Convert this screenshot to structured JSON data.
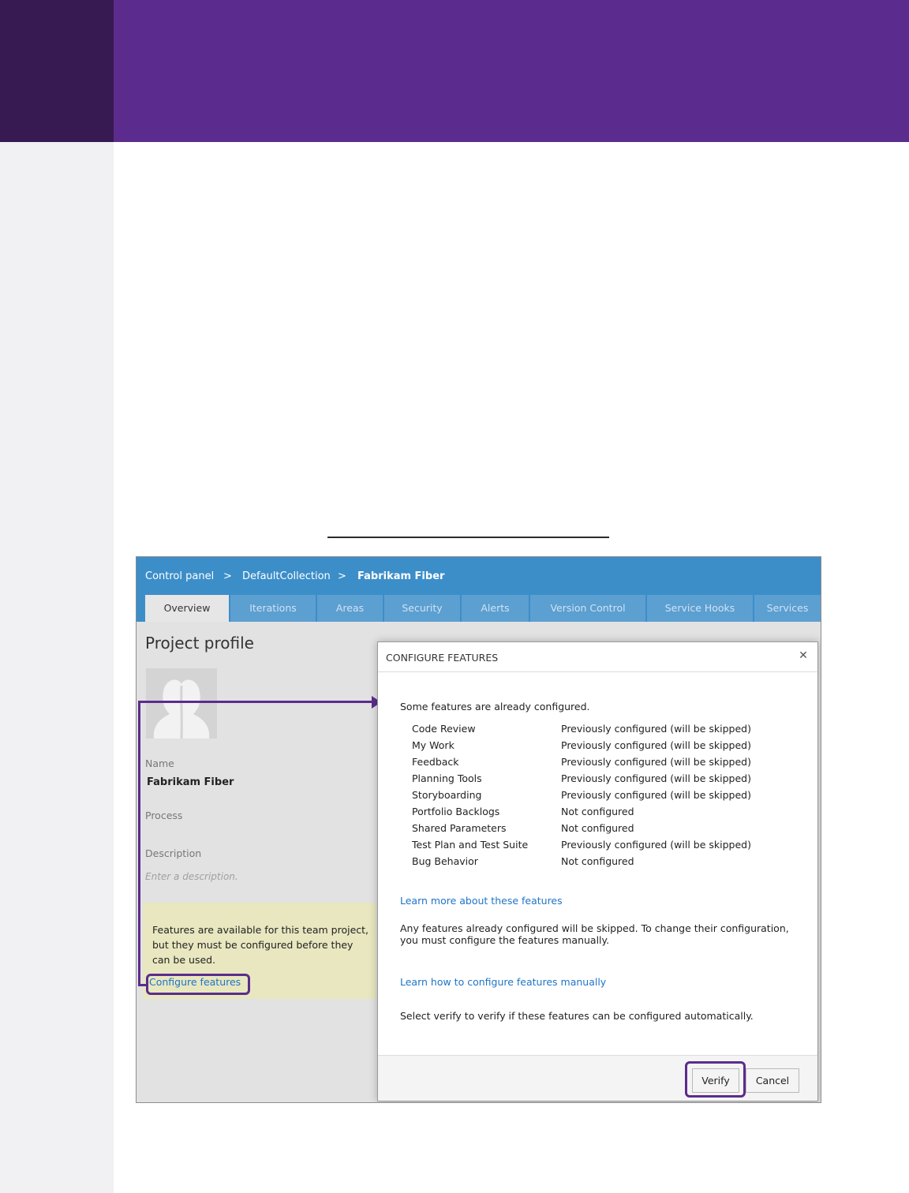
{
  "colors": {
    "brand_purple": "#5b2c8d",
    "rail_dark": "#371a52",
    "nav_blue": "#3c8ec9",
    "link_blue": "#1f74c7",
    "notice_yellow": "#e8e7c0"
  },
  "breadcrumb": {
    "item1": "Control panel",
    "sep1": ">",
    "item2": "DefaultCollection",
    "sep2": ">",
    "item3": "Fabrikam Fiber"
  },
  "tabs": [
    "Overview",
    "Iterations",
    "Areas",
    "Security",
    "Alerts",
    "Version Control",
    "Service Hooks",
    "Services"
  ],
  "profile": {
    "title": "Project profile",
    "avatar_icon": "user-silhouette-icon",
    "name_label": "Name",
    "name_value": "Fabrikam Fiber",
    "process_label": "Process",
    "description_label": "Description",
    "description_placeholder": "Enter a description."
  },
  "notice": {
    "text": "Features are available for this team project, but they must be configured before they can be used.",
    "link": "Configure features"
  },
  "dialog": {
    "title": "CONFIGURE FEATURES",
    "close_icon": "close-icon",
    "intro": "Some features are already configured.",
    "features": [
      {
        "name": "Code Review",
        "status": "Previously configured (will be skipped)"
      },
      {
        "name": "My Work",
        "status": "Previously configured (will be skipped)"
      },
      {
        "name": "Feedback",
        "status": "Previously configured (will be skipped)"
      },
      {
        "name": "Planning Tools",
        "status": "Previously configured (will be skipped)"
      },
      {
        "name": "Storyboarding",
        "status": "Previously configured (will be skipped)"
      },
      {
        "name": "Portfolio Backlogs",
        "status": "Not configured"
      },
      {
        "name": "Shared Parameters",
        "status": "Not configured"
      },
      {
        "name": "Test Plan and Test Suite",
        "status": "Previously configured (will be skipped)"
      },
      {
        "name": "Bug Behavior",
        "status": "Not configured"
      }
    ],
    "learn_more_link": "Learn more about these features",
    "skip_note": "Any features already configured will be skipped. To change their configuration, you must configure the features manually.",
    "manual_link": "Learn how to configure features manually",
    "verify_note": "Select verify to verify if these features can be configured automatically.",
    "verify_button": "Verify",
    "cancel_button": "Cancel"
  }
}
